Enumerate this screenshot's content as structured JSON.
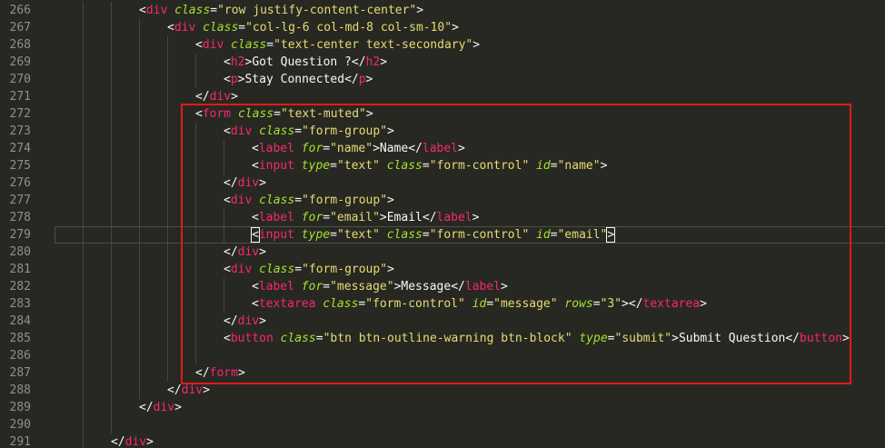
{
  "editor": {
    "current_line": 279,
    "highlight_color": "#E01A1A",
    "lines": [
      {
        "n": "266",
        "indent": 3,
        "tokens": [
          [
            "p",
            "<"
          ],
          [
            "t",
            "div"
          ],
          [
            "p",
            " "
          ],
          [
            "a",
            "class"
          ],
          [
            "p",
            "="
          ],
          [
            "s",
            "\"row justify-content-center\""
          ],
          [
            "p",
            ">"
          ]
        ]
      },
      {
        "n": "267",
        "indent": 4,
        "tokens": [
          [
            "p",
            "<"
          ],
          [
            "t",
            "div"
          ],
          [
            "p",
            " "
          ],
          [
            "a",
            "class"
          ],
          [
            "p",
            "="
          ],
          [
            "s",
            "\"col-lg-6 col-md-8 col-sm-10\""
          ],
          [
            "p",
            ">"
          ]
        ]
      },
      {
        "n": "268",
        "indent": 5,
        "tokens": [
          [
            "p",
            "<"
          ],
          [
            "t",
            "div"
          ],
          [
            "p",
            " "
          ],
          [
            "a",
            "class"
          ],
          [
            "p",
            "="
          ],
          [
            "s",
            "\"text-center text-secondary\""
          ],
          [
            "p",
            ">"
          ]
        ]
      },
      {
        "n": "269",
        "indent": 6,
        "tokens": [
          [
            "p",
            "<"
          ],
          [
            "t",
            "h2"
          ],
          [
            "p",
            ">"
          ],
          [
            "tx",
            "Got Question ?"
          ],
          [
            "p",
            "</"
          ],
          [
            "t",
            "h2"
          ],
          [
            "p",
            ">"
          ]
        ]
      },
      {
        "n": "270",
        "indent": 6,
        "tokens": [
          [
            "p",
            "<"
          ],
          [
            "t",
            "p"
          ],
          [
            "p",
            ">"
          ],
          [
            "tx",
            "Stay Connected"
          ],
          [
            "p",
            "</"
          ],
          [
            "t",
            "p"
          ],
          [
            "p",
            ">"
          ]
        ]
      },
      {
        "n": "271",
        "indent": 5,
        "tokens": [
          [
            "p",
            "</"
          ],
          [
            "t",
            "div"
          ],
          [
            "p",
            ">"
          ]
        ]
      },
      {
        "n": "272",
        "indent": 5,
        "tokens": [
          [
            "p",
            "<"
          ],
          [
            "t",
            "form"
          ],
          [
            "p",
            " "
          ],
          [
            "a",
            "class"
          ],
          [
            "p",
            "="
          ],
          [
            "s",
            "\"text-muted\""
          ],
          [
            "p",
            ">"
          ]
        ]
      },
      {
        "n": "273",
        "indent": 6,
        "tokens": [
          [
            "p",
            "<"
          ],
          [
            "t",
            "div"
          ],
          [
            "p",
            " "
          ],
          [
            "a",
            "class"
          ],
          [
            "p",
            "="
          ],
          [
            "s",
            "\"form-group\""
          ],
          [
            "p",
            ">"
          ]
        ]
      },
      {
        "n": "274",
        "indent": 7,
        "tokens": [
          [
            "p",
            "<"
          ],
          [
            "t",
            "label"
          ],
          [
            "p",
            " "
          ],
          [
            "a",
            "for"
          ],
          [
            "p",
            "="
          ],
          [
            "s",
            "\"name\""
          ],
          [
            "p",
            ">"
          ],
          [
            "tx",
            "Name"
          ],
          [
            "p",
            "</"
          ],
          [
            "t",
            "label"
          ],
          [
            "p",
            ">"
          ]
        ]
      },
      {
        "n": "275",
        "indent": 7,
        "tokens": [
          [
            "p",
            "<"
          ],
          [
            "t",
            "input"
          ],
          [
            "p",
            " "
          ],
          [
            "a",
            "type"
          ],
          [
            "p",
            "="
          ],
          [
            "s",
            "\"text\""
          ],
          [
            "p",
            " "
          ],
          [
            "a",
            "class"
          ],
          [
            "p",
            "="
          ],
          [
            "s",
            "\"form-control\""
          ],
          [
            "p",
            " "
          ],
          [
            "a",
            "id"
          ],
          [
            "p",
            "="
          ],
          [
            "s",
            "\"name\""
          ],
          [
            "p",
            ">"
          ]
        ]
      },
      {
        "n": "276",
        "indent": 6,
        "tokens": [
          [
            "p",
            "</"
          ],
          [
            "t",
            "div"
          ],
          [
            "p",
            ">"
          ]
        ]
      },
      {
        "n": "277",
        "indent": 6,
        "tokens": [
          [
            "p",
            "<"
          ],
          [
            "t",
            "div"
          ],
          [
            "p",
            " "
          ],
          [
            "a",
            "class"
          ],
          [
            "p",
            "="
          ],
          [
            "s",
            "\"form-group\""
          ],
          [
            "p",
            ">"
          ]
        ]
      },
      {
        "n": "278",
        "indent": 7,
        "tokens": [
          [
            "p",
            "<"
          ],
          [
            "t",
            "label"
          ],
          [
            "p",
            " "
          ],
          [
            "a",
            "for"
          ],
          [
            "p",
            "="
          ],
          [
            "s",
            "\"email\""
          ],
          [
            "p",
            ">"
          ],
          [
            "tx",
            "Email"
          ],
          [
            "p",
            "</"
          ],
          [
            "t",
            "label"
          ],
          [
            "p",
            ">"
          ]
        ]
      },
      {
        "n": "279",
        "indent": 7,
        "tokens": [
          [
            "pm",
            "<"
          ],
          [
            "t",
            "input"
          ],
          [
            "p",
            " "
          ],
          [
            "a",
            "type"
          ],
          [
            "p",
            "="
          ],
          [
            "s",
            "\"text\""
          ],
          [
            "p",
            " "
          ],
          [
            "a",
            "class"
          ],
          [
            "p",
            "="
          ],
          [
            "s",
            "\"form-control\""
          ],
          [
            "p",
            " "
          ],
          [
            "a",
            "id"
          ],
          [
            "p",
            "="
          ],
          [
            "s",
            "\"email\""
          ],
          [
            "pm",
            ">"
          ]
        ]
      },
      {
        "n": "280",
        "indent": 6,
        "tokens": [
          [
            "p",
            "</"
          ],
          [
            "t",
            "div"
          ],
          [
            "p",
            ">"
          ]
        ]
      },
      {
        "n": "281",
        "indent": 6,
        "tokens": [
          [
            "p",
            "<"
          ],
          [
            "t",
            "div"
          ],
          [
            "p",
            " "
          ],
          [
            "a",
            "class"
          ],
          [
            "p",
            "="
          ],
          [
            "s",
            "\"form-group\""
          ],
          [
            "p",
            ">"
          ]
        ]
      },
      {
        "n": "282",
        "indent": 7,
        "tokens": [
          [
            "p",
            "<"
          ],
          [
            "t",
            "label"
          ],
          [
            "p",
            " "
          ],
          [
            "a",
            "for"
          ],
          [
            "p",
            "="
          ],
          [
            "s",
            "\"message\""
          ],
          [
            "p",
            ">"
          ],
          [
            "tx",
            "Message"
          ],
          [
            "p",
            "</"
          ],
          [
            "t",
            "label"
          ],
          [
            "p",
            ">"
          ]
        ]
      },
      {
        "n": "283",
        "indent": 7,
        "tokens": [
          [
            "p",
            "<"
          ],
          [
            "t",
            "textarea"
          ],
          [
            "p",
            " "
          ],
          [
            "a",
            "class"
          ],
          [
            "p",
            "="
          ],
          [
            "s",
            "\"form-control\""
          ],
          [
            "p",
            " "
          ],
          [
            "a",
            "id"
          ],
          [
            "p",
            "="
          ],
          [
            "s",
            "\"message\""
          ],
          [
            "p",
            " "
          ],
          [
            "a",
            "rows"
          ],
          [
            "p",
            "="
          ],
          [
            "s",
            "\"3\""
          ],
          [
            "p",
            "></"
          ],
          [
            "t",
            "textarea"
          ],
          [
            "p",
            ">"
          ]
        ]
      },
      {
        "n": "284",
        "indent": 6,
        "tokens": [
          [
            "p",
            "</"
          ],
          [
            "t",
            "div"
          ],
          [
            "p",
            ">"
          ]
        ]
      },
      {
        "n": "285",
        "indent": 6,
        "tokens": [
          [
            "p",
            "<"
          ],
          [
            "t",
            "button"
          ],
          [
            "p",
            " "
          ],
          [
            "a",
            "class"
          ],
          [
            "p",
            "="
          ],
          [
            "s",
            "\"btn btn-outline-warning btn-block\""
          ],
          [
            "p",
            " "
          ],
          [
            "a",
            "type"
          ],
          [
            "p",
            "="
          ],
          [
            "s",
            "\"submit\""
          ],
          [
            "p",
            ">"
          ],
          [
            "tx",
            "Submit Question"
          ],
          [
            "p",
            "</"
          ],
          [
            "t",
            "button"
          ],
          [
            "p",
            ">"
          ]
        ]
      },
      {
        "n": "286",
        "indent": 6,
        "tokens": []
      },
      {
        "n": "287",
        "indent": 5,
        "tokens": [
          [
            "p",
            "</"
          ],
          [
            "t",
            "form"
          ],
          [
            "p",
            ">"
          ]
        ]
      },
      {
        "n": "288",
        "indent": 4,
        "tokens": [
          [
            "p",
            "</"
          ],
          [
            "t",
            "div"
          ],
          [
            "p",
            ">"
          ]
        ]
      },
      {
        "n": "289",
        "indent": 3,
        "tokens": [
          [
            "p",
            "</"
          ],
          [
            "t",
            "div"
          ],
          [
            "p",
            ">"
          ]
        ]
      },
      {
        "n": "290",
        "indent": 3,
        "tokens": []
      },
      {
        "n": "291",
        "indent": 2,
        "tokens": [
          [
            "p",
            "</"
          ],
          [
            "t",
            "div"
          ],
          [
            "p",
            ">"
          ]
        ]
      }
    ]
  }
}
